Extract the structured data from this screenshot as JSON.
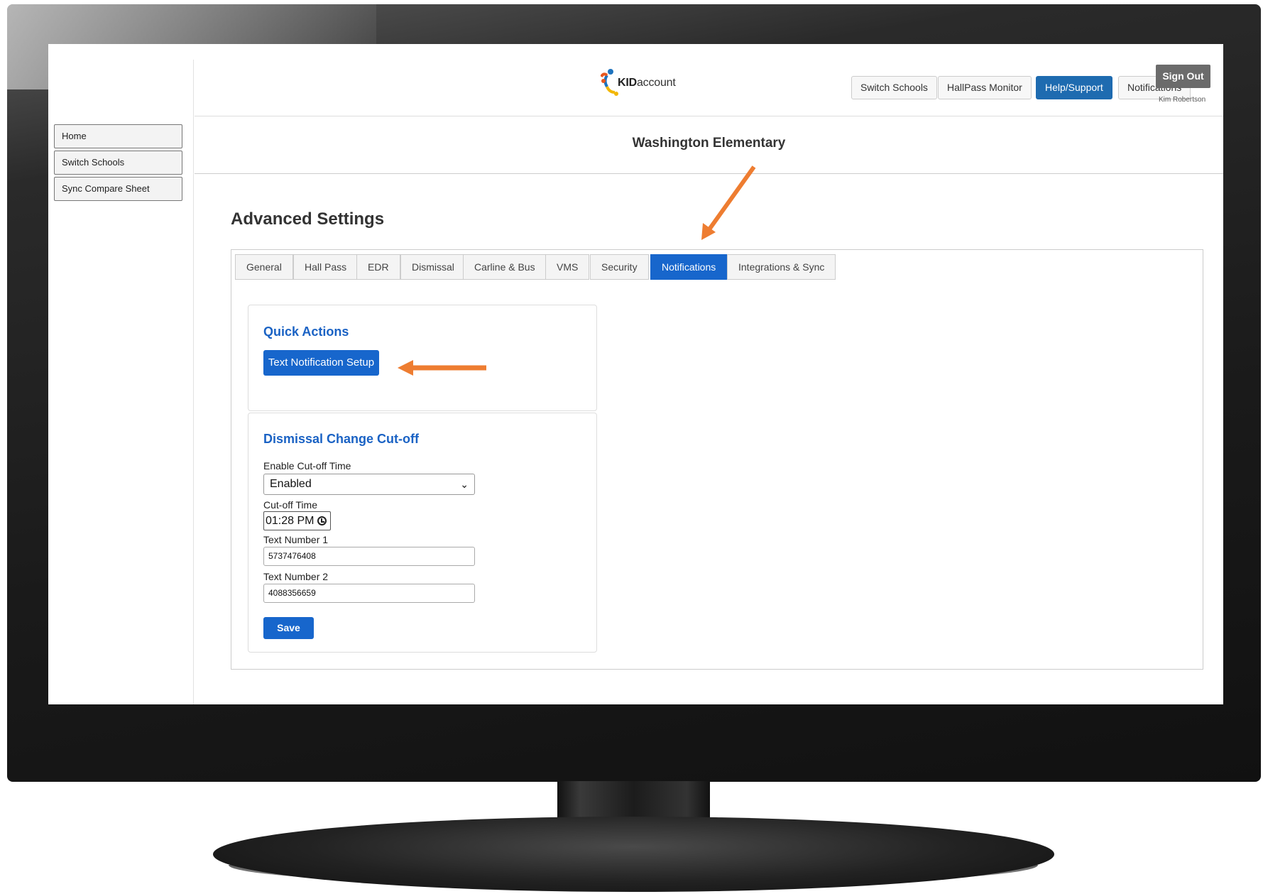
{
  "sidebar": {
    "items": [
      {
        "label": "Home"
      },
      {
        "label": "Switch Schools"
      },
      {
        "label": "Sync Compare Sheet"
      }
    ]
  },
  "header": {
    "logo_prefix": "KID",
    "logo_suffix": "account",
    "nav": [
      {
        "label": "Switch Schools"
      },
      {
        "label": "HallPass Monitor"
      },
      {
        "label": "Help/Support"
      },
      {
        "label": "Notifications"
      }
    ],
    "sign_out_label": "Sign Out",
    "user_name": "Kim Robertson"
  },
  "school_name": "Washington Elementary",
  "page_title": "Advanced Settings",
  "tabs": [
    {
      "label": "General"
    },
    {
      "label": "Hall Pass"
    },
    {
      "label": "EDR"
    },
    {
      "label": "Dismissal"
    },
    {
      "label": "Carline & Bus"
    },
    {
      "label": "VMS"
    },
    {
      "label": "Security"
    },
    {
      "label": "Notifications",
      "active": true
    },
    {
      "label": "Integrations & Sync"
    }
  ],
  "quick_actions": {
    "title": "Quick Actions",
    "button_label": "Text Notification Setup"
  },
  "dismissal_cutoff": {
    "title": "Dismissal Change Cut-off",
    "enable_label": "Enable Cut-off Time",
    "enable_value": "Enabled",
    "cutoff_label": "Cut-off Time",
    "cutoff_value": "01:28 PM",
    "text1_label": "Text Number 1",
    "text1_value": "5737476408",
    "text2_label": "Text Number 2",
    "text2_value": "4088356659",
    "save_label": "Save"
  },
  "colors": {
    "accent": "#1766cc",
    "help_button": "#1e6bb0",
    "annotation_arrow": "#ee7d31",
    "sign_out": "#6b6b6b"
  }
}
